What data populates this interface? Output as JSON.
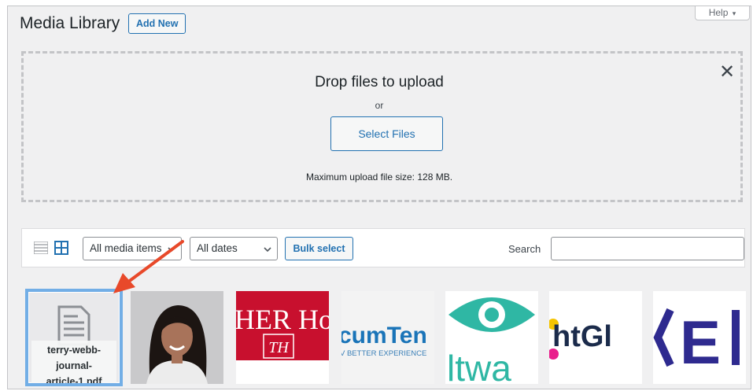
{
  "header": {
    "title": "Media Library",
    "add_new_label": "Add New",
    "help_label": "Help"
  },
  "uploader": {
    "title": "Drop files to upload",
    "or_text": "or",
    "select_files_label": "Select Files",
    "max_size_text": "Maximum upload file size: 128 MB."
  },
  "toolbar": {
    "media_filter": "All media items",
    "date_filter": "All dates",
    "bulk_select_label": "Bulk select",
    "search_label": "Search",
    "search_value": ""
  },
  "grid": {
    "items": [
      {
        "kind": "pdf",
        "name": "terry-webb-journal-article-1.pdf",
        "label_lines": [
          "terry-webb-",
          "journal-",
          "article-1.pdf"
        ]
      },
      {
        "kind": "photo",
        "name": "portrait photo"
      },
      {
        "kind": "logo",
        "text": "HER Ho",
        "monogram": "TH",
        "color": "#c8102e"
      },
      {
        "kind": "logo",
        "text": "cumTen",
        "subtext": "V BETTER EXPERIENCE",
        "color": "#1a74b8"
      },
      {
        "kind": "logo",
        "text": "ltwa",
        "color": "#2fb7a4"
      },
      {
        "kind": "logo",
        "text": "htGl",
        "color": "#1b2b4b"
      },
      {
        "kind": "logo",
        "text": "E",
        "color": "#2e2a8f"
      }
    ]
  },
  "colors": {
    "accent": "#2271b1",
    "selection": "#72aee6",
    "annotation_arrow": "#e8492a"
  }
}
